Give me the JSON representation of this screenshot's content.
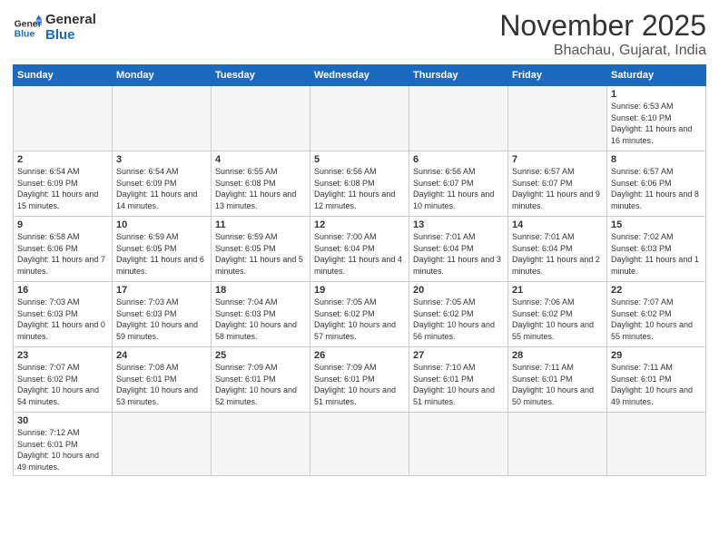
{
  "header": {
    "logo_general": "General",
    "logo_blue": "Blue",
    "title": "November 2025",
    "subtitle": "Bhachau, Gujarat, India"
  },
  "weekdays": [
    "Sunday",
    "Monday",
    "Tuesday",
    "Wednesday",
    "Thursday",
    "Friday",
    "Saturday"
  ],
  "weeks": [
    [
      {
        "day": "",
        "empty": true
      },
      {
        "day": "",
        "empty": true
      },
      {
        "day": "",
        "empty": true
      },
      {
        "day": "",
        "empty": true
      },
      {
        "day": "",
        "empty": true
      },
      {
        "day": "",
        "empty": true
      },
      {
        "day": "1",
        "sunrise": "6:53 AM",
        "sunset": "6:10 PM",
        "daylight": "11 hours and 16 minutes."
      }
    ],
    [
      {
        "day": "2",
        "sunrise": "6:54 AM",
        "sunset": "6:09 PM",
        "daylight": "11 hours and 15 minutes."
      },
      {
        "day": "3",
        "sunrise": "6:54 AM",
        "sunset": "6:09 PM",
        "daylight": "11 hours and 14 minutes."
      },
      {
        "day": "4",
        "sunrise": "6:55 AM",
        "sunset": "6:08 PM",
        "daylight": "11 hours and 13 minutes."
      },
      {
        "day": "5",
        "sunrise": "6:56 AM",
        "sunset": "6:08 PM",
        "daylight": "11 hours and 12 minutes."
      },
      {
        "day": "6",
        "sunrise": "6:56 AM",
        "sunset": "6:07 PM",
        "daylight": "11 hours and 10 minutes."
      },
      {
        "day": "7",
        "sunrise": "6:57 AM",
        "sunset": "6:07 PM",
        "daylight": "11 hours and 9 minutes."
      },
      {
        "day": "8",
        "sunrise": "6:57 AM",
        "sunset": "6:06 PM",
        "daylight": "11 hours and 8 minutes."
      }
    ],
    [
      {
        "day": "9",
        "sunrise": "6:58 AM",
        "sunset": "6:06 PM",
        "daylight": "11 hours and 7 minutes."
      },
      {
        "day": "10",
        "sunrise": "6:59 AM",
        "sunset": "6:05 PM",
        "daylight": "11 hours and 6 minutes."
      },
      {
        "day": "11",
        "sunrise": "6:59 AM",
        "sunset": "6:05 PM",
        "daylight": "11 hours and 5 minutes."
      },
      {
        "day": "12",
        "sunrise": "7:00 AM",
        "sunset": "6:04 PM",
        "daylight": "11 hours and 4 minutes."
      },
      {
        "day": "13",
        "sunrise": "7:01 AM",
        "sunset": "6:04 PM",
        "daylight": "11 hours and 3 minutes."
      },
      {
        "day": "14",
        "sunrise": "7:01 AM",
        "sunset": "6:04 PM",
        "daylight": "11 hours and 2 minutes."
      },
      {
        "day": "15",
        "sunrise": "7:02 AM",
        "sunset": "6:03 PM",
        "daylight": "11 hours and 1 minute."
      }
    ],
    [
      {
        "day": "16",
        "sunrise": "7:03 AM",
        "sunset": "6:03 PM",
        "daylight": "11 hours and 0 minutes."
      },
      {
        "day": "17",
        "sunrise": "7:03 AM",
        "sunset": "6:03 PM",
        "daylight": "10 hours and 59 minutes."
      },
      {
        "day": "18",
        "sunrise": "7:04 AM",
        "sunset": "6:03 PM",
        "daylight": "10 hours and 58 minutes."
      },
      {
        "day": "19",
        "sunrise": "7:05 AM",
        "sunset": "6:02 PM",
        "daylight": "10 hours and 57 minutes."
      },
      {
        "day": "20",
        "sunrise": "7:05 AM",
        "sunset": "6:02 PM",
        "daylight": "10 hours and 56 minutes."
      },
      {
        "day": "21",
        "sunrise": "7:06 AM",
        "sunset": "6:02 PM",
        "daylight": "10 hours and 55 minutes."
      },
      {
        "day": "22",
        "sunrise": "7:07 AM",
        "sunset": "6:02 PM",
        "daylight": "10 hours and 55 minutes."
      }
    ],
    [
      {
        "day": "23",
        "sunrise": "7:07 AM",
        "sunset": "6:02 PM",
        "daylight": "10 hours and 54 minutes."
      },
      {
        "day": "24",
        "sunrise": "7:08 AM",
        "sunset": "6:01 PM",
        "daylight": "10 hours and 53 minutes."
      },
      {
        "day": "25",
        "sunrise": "7:09 AM",
        "sunset": "6:01 PM",
        "daylight": "10 hours and 52 minutes."
      },
      {
        "day": "26",
        "sunrise": "7:09 AM",
        "sunset": "6:01 PM",
        "daylight": "10 hours and 51 minutes."
      },
      {
        "day": "27",
        "sunrise": "7:10 AM",
        "sunset": "6:01 PM",
        "daylight": "10 hours and 51 minutes."
      },
      {
        "day": "28",
        "sunrise": "7:11 AM",
        "sunset": "6:01 PM",
        "daylight": "10 hours and 50 minutes."
      },
      {
        "day": "29",
        "sunrise": "7:11 AM",
        "sunset": "6:01 PM",
        "daylight": "10 hours and 49 minutes."
      }
    ],
    [
      {
        "day": "30",
        "sunrise": "7:12 AM",
        "sunset": "6:01 PM",
        "daylight": "10 hours and 49 minutes."
      },
      {
        "day": "",
        "empty": true
      },
      {
        "day": "",
        "empty": true
      },
      {
        "day": "",
        "empty": true
      },
      {
        "day": "",
        "empty": true
      },
      {
        "day": "",
        "empty": true
      },
      {
        "day": "",
        "empty": true
      }
    ]
  ]
}
